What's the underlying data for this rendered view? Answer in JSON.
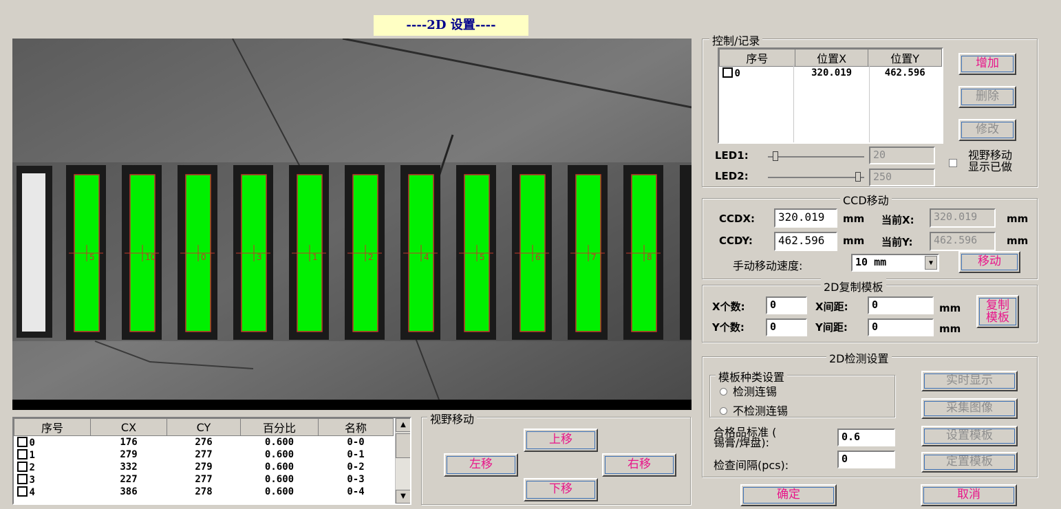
{
  "window": {
    "title": "----2D 设置----"
  },
  "record_panel": {
    "title": "控制/记录",
    "columns": [
      "序号",
      "位置X",
      "位置Y"
    ],
    "rows": [
      {
        "index": "0",
        "x": "320.019",
        "y": "462.596"
      }
    ],
    "add_label": "增加",
    "delete_label": "删除",
    "modify_label": "修改",
    "led1_label": "LED1:",
    "led1_value": "20",
    "led2_label": "LED2:",
    "led2_value": "250",
    "view_checkbox_label_1": "视野移动",
    "view_checkbox_label_2": "显示已做"
  },
  "ccd_panel": {
    "title": "CCD移动",
    "ccdx_label": "CCDX:",
    "ccdx_value": "320.019",
    "ccdy_label": "CCDY:",
    "ccdy_value": "462.596",
    "unit": "mm",
    "cur_x_label": "当前X:",
    "cur_x_value": "320.019",
    "cur_y_label": "当前Y:",
    "cur_y_value": "462.596",
    "speed_label": "手动移动速度:",
    "speed_value": "10 mm",
    "move_label": "移动"
  },
  "copy_panel": {
    "title": "2D复制模板",
    "x_count_label": "X个数:",
    "x_count_value": "0",
    "x_pitch_label": "X间距:",
    "x_pitch_value": "0",
    "y_count_label": "Y个数:",
    "y_count_value": "0",
    "y_pitch_label": "Y间距:",
    "y_pitch_value": "0",
    "unit": "mm",
    "copy_label_1": "复制",
    "copy_label_2": "模板"
  },
  "detect_panel": {
    "title": "2D检测设置",
    "template_group_title": "模板种类设置",
    "radio_1": "检测连锡",
    "radio_2": "不检测连锡",
    "standard_label_1": "合格品标准  (",
    "standard_label_2": "锡膏/焊盘):",
    "standard_value": "0.6",
    "interval_label": "检查间隔(pcs):",
    "interval_value": "0",
    "realtime_label": "实时显示",
    "capture_label": "采集图像",
    "set_template_label": "设置模板",
    "locate_template_label": "定置模板"
  },
  "result_table": {
    "columns": [
      "序号",
      "CX",
      "CY",
      "百分比",
      "名称"
    ],
    "rows": [
      {
        "index": "0",
        "cx": "176",
        "cy": "276",
        "pct": "0.600",
        "name": "0-0"
      },
      {
        "index": "1",
        "cx": "279",
        "cy": "277",
        "pct": "0.600",
        "name": "0-1"
      },
      {
        "index": "2",
        "cx": "332",
        "cy": "279",
        "pct": "0.600",
        "name": "0-2"
      },
      {
        "index": "3",
        "cx": "227",
        "cy": "277",
        "pct": "0.600",
        "name": "0-3"
      },
      {
        "index": "4",
        "cx": "386",
        "cy": "278",
        "pct": "0.600",
        "name": "0-4"
      }
    ]
  },
  "view_move": {
    "title": "视野移动",
    "up_label": "上移",
    "down_label": "下移",
    "left_label": "左移",
    "right_label": "右移"
  },
  "footer": {
    "ok_label": "确定",
    "cancel_label": "取消"
  },
  "camera_pad_labels": [
    "5",
    "10",
    "0",
    "3",
    "1",
    "2",
    "4",
    "5",
    "6",
    "7",
    "8"
  ]
}
